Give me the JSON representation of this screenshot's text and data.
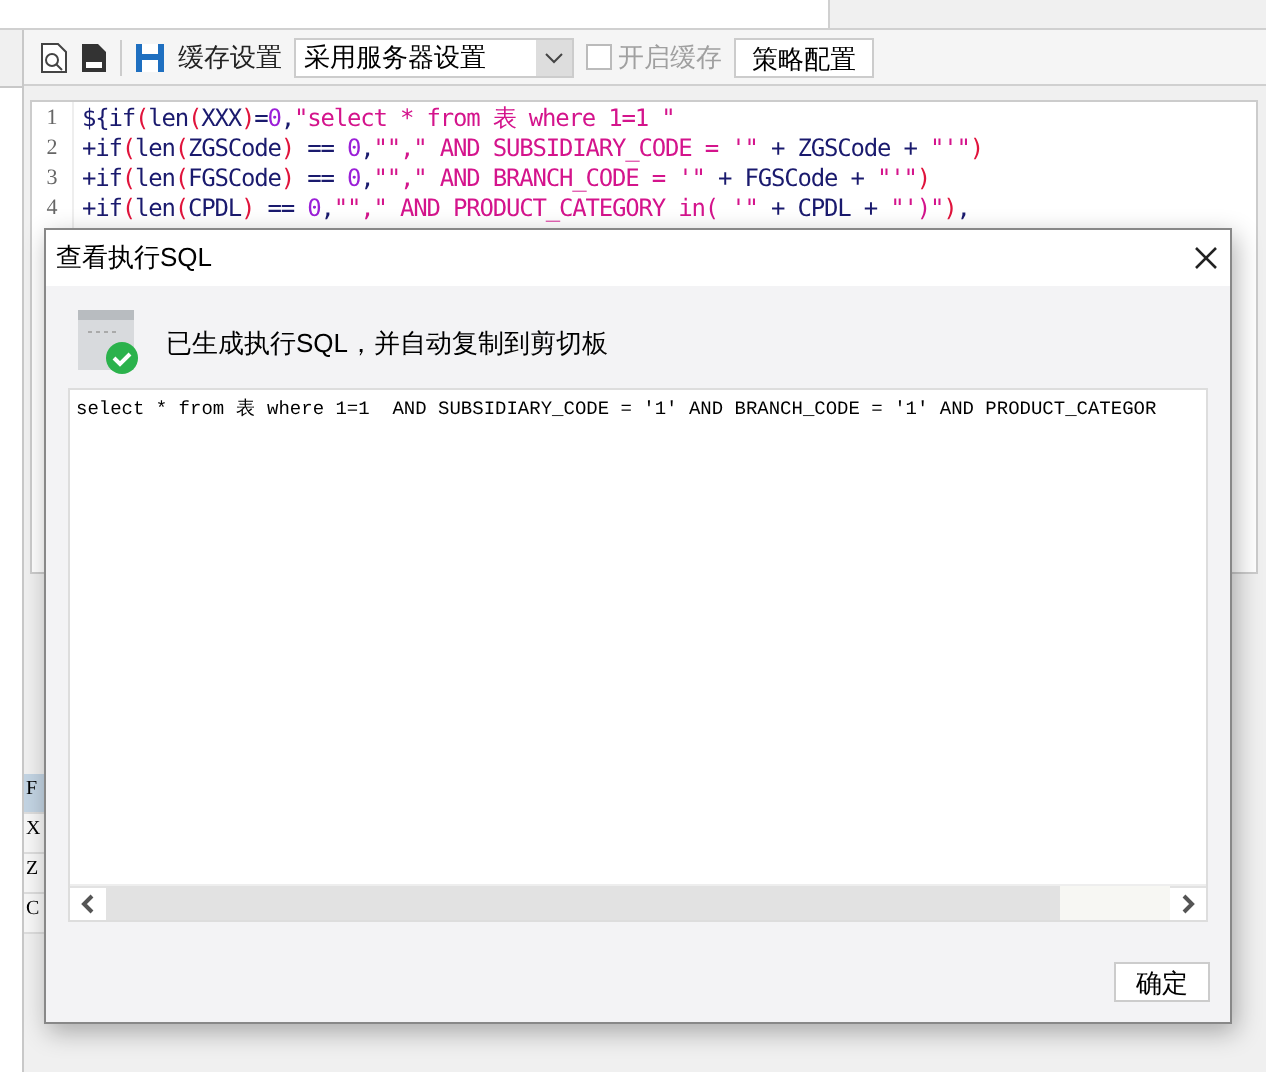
{
  "toolbar": {
    "cache_label": "缓存设置",
    "cache_select": {
      "value": "采用服务器设置"
    },
    "enable_cache": {
      "label": "开启缓存",
      "checked": false,
      "disabled": true
    },
    "strategy_button": "策略配置"
  },
  "editor": {
    "lines": [
      {
        "number": "1",
        "tokens": [
          {
            "kind": "plain",
            "text": "${if"
          },
          {
            "kind": "paren",
            "text": "("
          },
          {
            "kind": "plain",
            "text": "len"
          },
          {
            "kind": "paren",
            "text": "("
          },
          {
            "kind": "plain",
            "text": "XXX"
          },
          {
            "kind": "paren",
            "text": ")"
          },
          {
            "kind": "plain",
            "text": "="
          },
          {
            "kind": "num",
            "text": "0"
          },
          {
            "kind": "plain",
            "text": ","
          },
          {
            "kind": "str",
            "text": "\"select * from 表 where 1=1 \""
          }
        ]
      },
      {
        "number": "2",
        "tokens": [
          {
            "kind": "plain",
            "text": "+if"
          },
          {
            "kind": "paren",
            "text": "("
          },
          {
            "kind": "plain",
            "text": "len"
          },
          {
            "kind": "paren",
            "text": "("
          },
          {
            "kind": "plain",
            "text": "ZGSCode"
          },
          {
            "kind": "paren",
            "text": ")"
          },
          {
            "kind": "plain",
            "text": " == "
          },
          {
            "kind": "num",
            "text": "0"
          },
          {
            "kind": "plain",
            "text": ","
          },
          {
            "kind": "str",
            "text": "\"\",\" AND SUBSIDIARY_CODE = '\""
          },
          {
            "kind": "plain",
            "text": " + ZGSCode + "
          },
          {
            "kind": "str",
            "text": "\"'\""
          },
          {
            "kind": "paren",
            "text": ")"
          }
        ]
      },
      {
        "number": "3",
        "tokens": [
          {
            "kind": "plain",
            "text": "+if"
          },
          {
            "kind": "paren",
            "text": "("
          },
          {
            "kind": "plain",
            "text": "len"
          },
          {
            "kind": "paren",
            "text": "("
          },
          {
            "kind": "plain",
            "text": "FGSCode"
          },
          {
            "kind": "paren",
            "text": ")"
          },
          {
            "kind": "plain",
            "text": " == "
          },
          {
            "kind": "num",
            "text": "0"
          },
          {
            "kind": "plain",
            "text": ","
          },
          {
            "kind": "str",
            "text": "\"\",\" AND BRANCH_CODE = '\""
          },
          {
            "kind": "plain",
            "text": " + FGSCode + "
          },
          {
            "kind": "str",
            "text": "\"'\""
          },
          {
            "kind": "paren",
            "text": ")"
          }
        ]
      },
      {
        "number": "4",
        "tokens": [
          {
            "kind": "plain",
            "text": "+if"
          },
          {
            "kind": "paren",
            "text": "("
          },
          {
            "kind": "plain",
            "text": "len"
          },
          {
            "kind": "paren",
            "text": "("
          },
          {
            "kind": "plain",
            "text": "CPDL"
          },
          {
            "kind": "paren",
            "text": ")"
          },
          {
            "kind": "plain",
            "text": " == "
          },
          {
            "kind": "num",
            "text": "0"
          },
          {
            "kind": "plain",
            "text": ","
          },
          {
            "kind": "str",
            "text": "\"\",\" AND PRODUCT_CATEGORY in( '\""
          },
          {
            "kind": "plain",
            "text": " + CPDL + "
          },
          {
            "kind": "str",
            "text": "\"')\""
          },
          {
            "kind": "paren",
            "text": ")"
          },
          {
            "kind": "plain",
            "text": ","
          }
        ]
      }
    ]
  },
  "side_list": [
    {
      "text": "F",
      "selected": true
    },
    {
      "text": "X",
      "selected": false
    },
    {
      "text": "Z",
      "selected": false
    },
    {
      "text": "C",
      "selected": false
    }
  ],
  "dialog": {
    "title": "查看执行SQL",
    "message": "已生成执行SQL，并自动复制到剪切板",
    "sql": "select * from 表 where 1=1  AND SUBSIDIARY_CODE = '1' AND BRANCH_CODE = '1' AND PRODUCT_CATEGOR",
    "ok_button": "确定"
  }
}
